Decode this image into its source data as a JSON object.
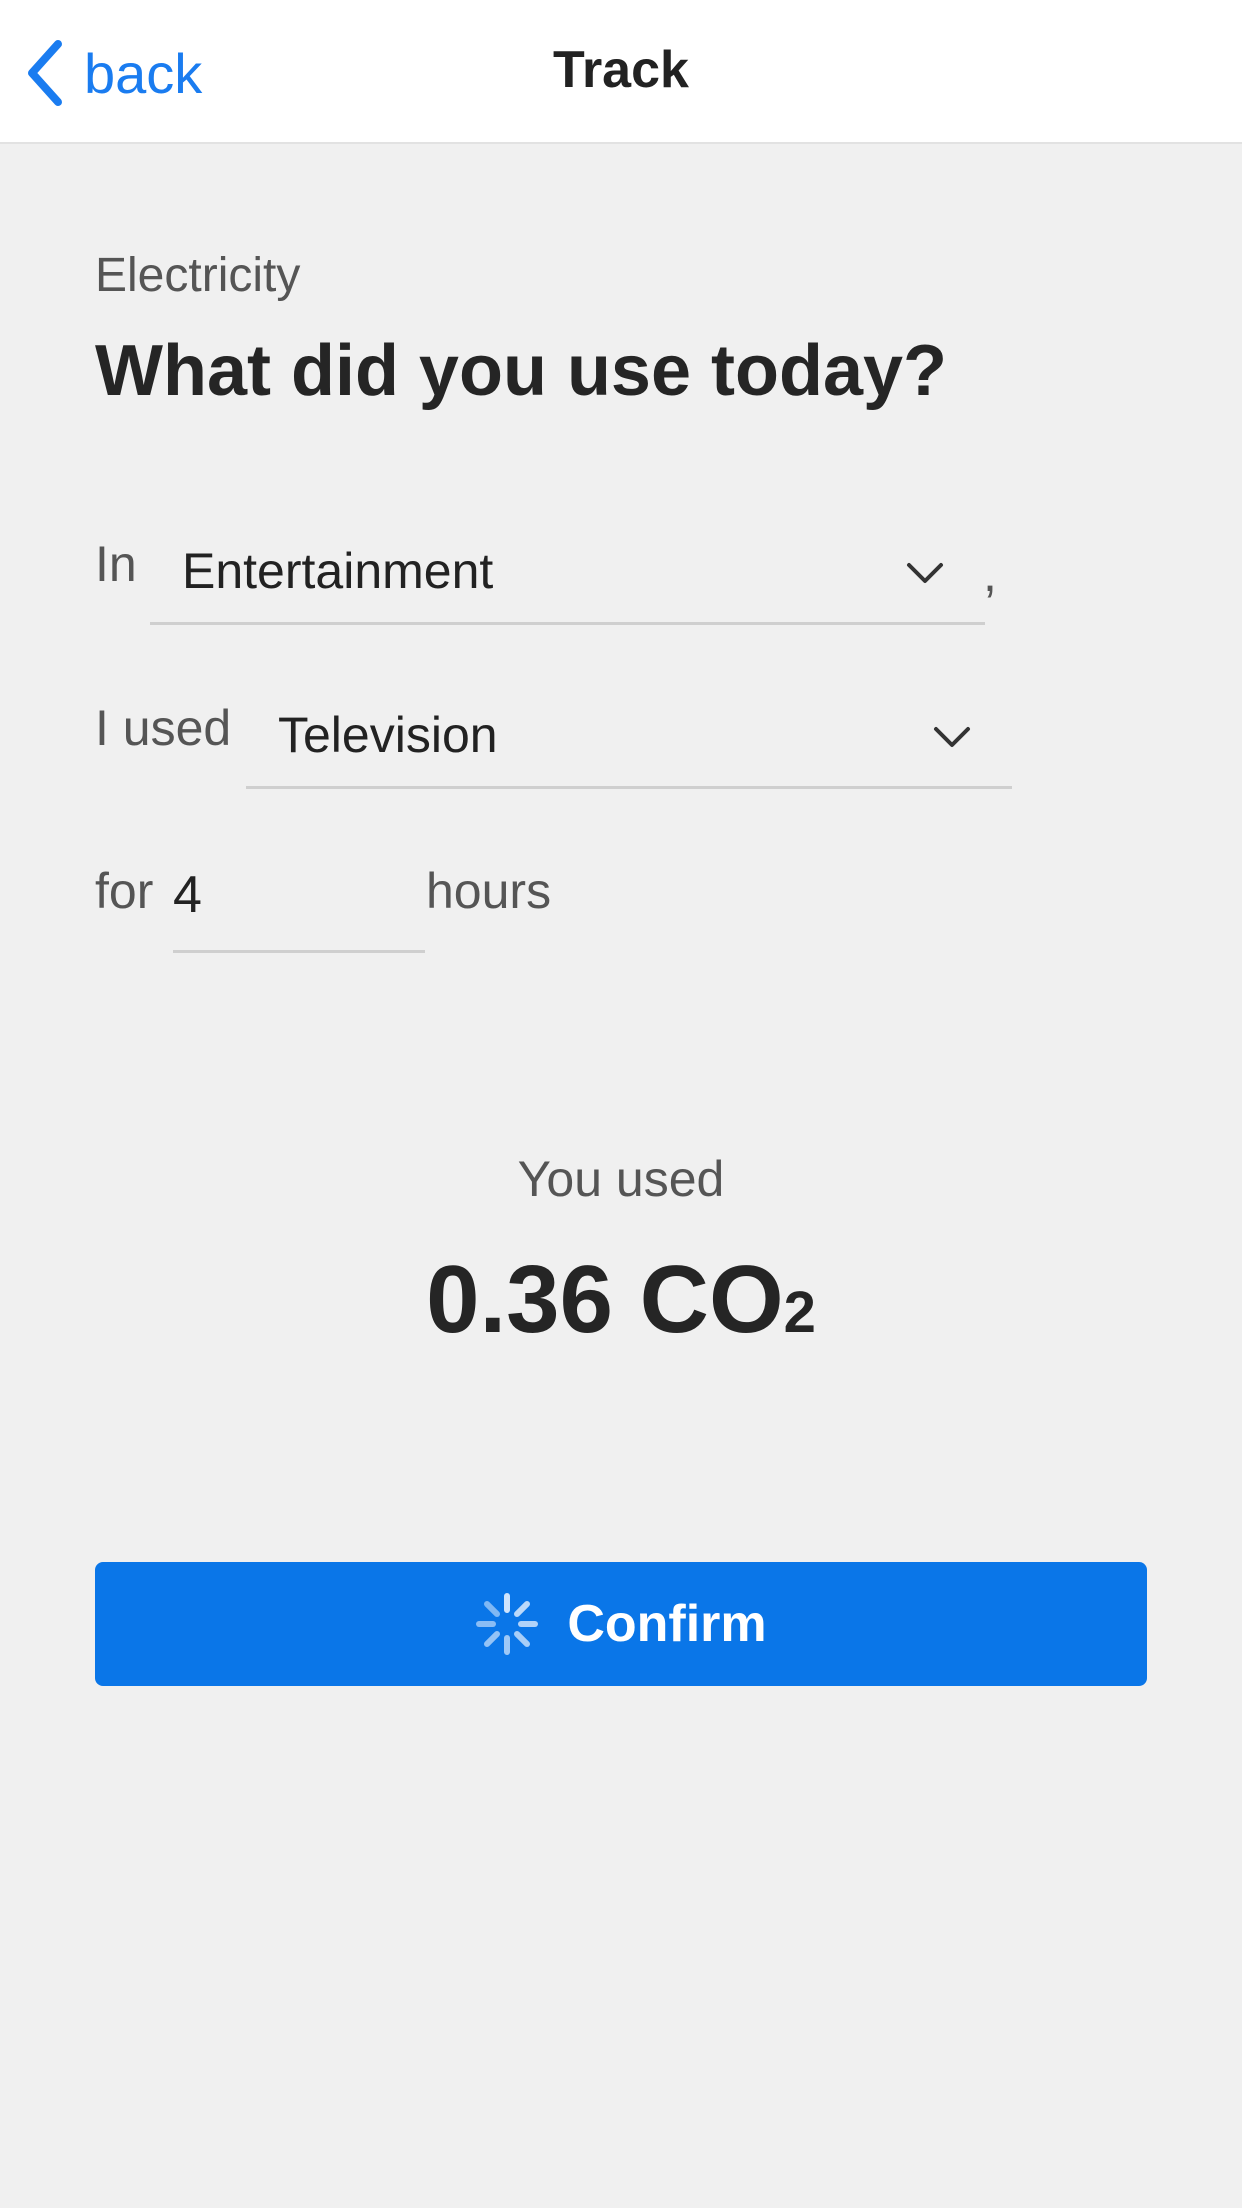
{
  "nav": {
    "back_label": "back",
    "title": "Track"
  },
  "form": {
    "category": "Electricity",
    "heading": "What did you use today?",
    "in_label": "In",
    "area_value": "Entertainment",
    "comma": ",",
    "used_label": "I used",
    "device_value": "Television",
    "for_label": "for",
    "hours_value": "4",
    "hours_unit": "hours"
  },
  "result": {
    "label": "You used",
    "amount": "0.36",
    "unit": "CO",
    "unit_sub": "2"
  },
  "confirm_label": "Confirm",
  "colors": {
    "accent": "#0a76e8",
    "link": "#1a7cf0",
    "background": "#f0f0f0"
  }
}
